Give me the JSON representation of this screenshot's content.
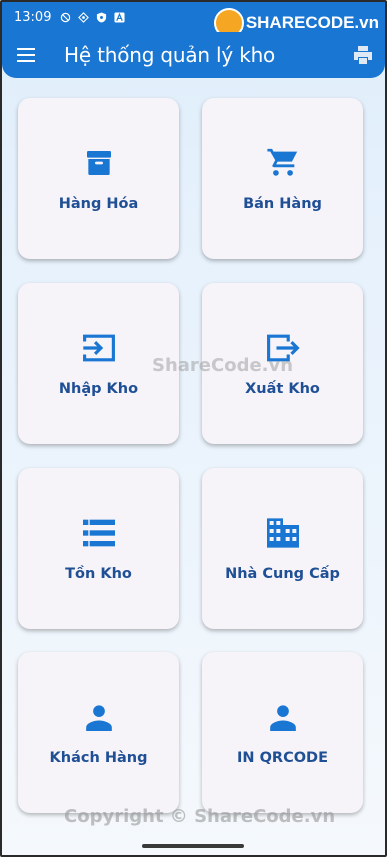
{
  "status_bar": {
    "time": "13:09"
  },
  "app_bar": {
    "title": "Hệ thống quản lý kho"
  },
  "watermark": {
    "logo_text": "SHARECODE.vn",
    "center_text": "ShareCode.vn",
    "footer_text": "Copyright © ShareCode.vn"
  },
  "menu": {
    "items": [
      {
        "label": "Hàng Hóa",
        "icon": "archive-icon"
      },
      {
        "label": "Bán Hàng",
        "icon": "shopping-cart-icon"
      },
      {
        "label": "Nhập Kho",
        "icon": "input-icon"
      },
      {
        "label": "Xuất Kho",
        "icon": "output-icon"
      },
      {
        "label": "Tồn Kho",
        "icon": "list-icon"
      },
      {
        "label": "Nhà Cung Cấp",
        "icon": "business-icon"
      },
      {
        "label": "Khách Hàng",
        "icon": "person-icon"
      },
      {
        "label": "IN QRCODE",
        "icon": "person-icon"
      }
    ]
  },
  "colors": {
    "primary": "#1976d2",
    "label": "#1f4f95",
    "card": "#f6f3f9"
  }
}
